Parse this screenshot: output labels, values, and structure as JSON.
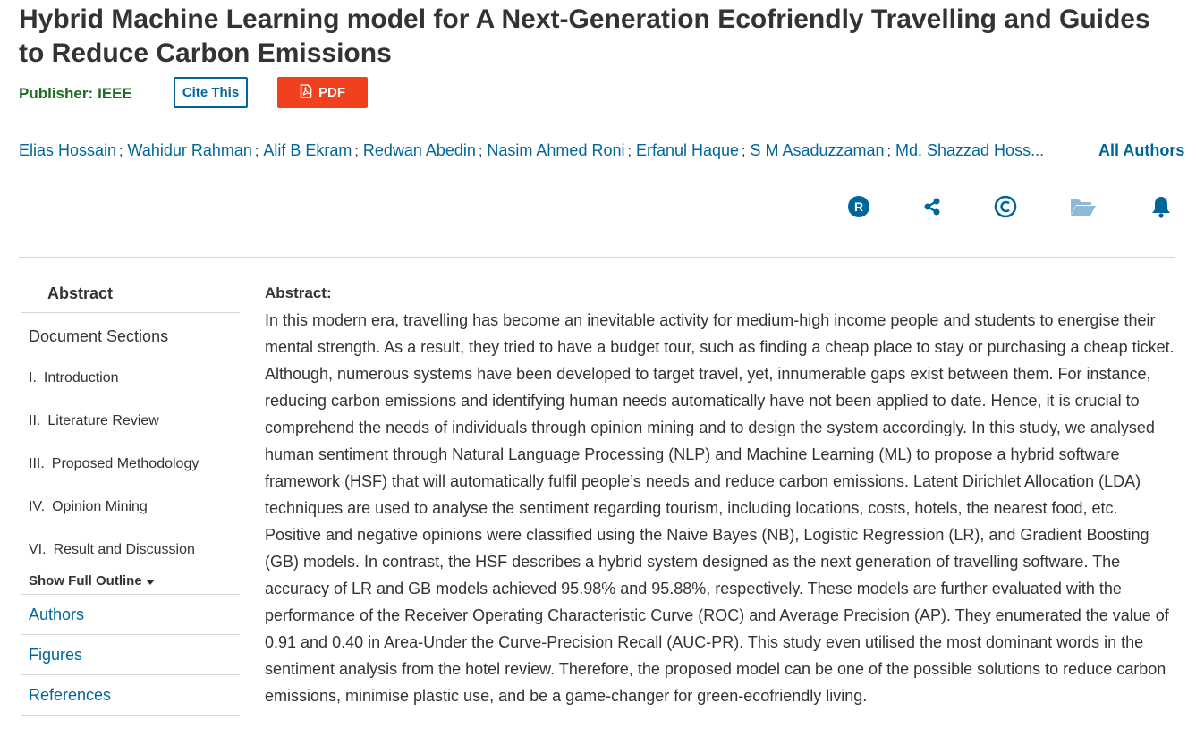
{
  "title": "Hybrid Machine Learning model for A Next-Generation Ecofriendly Travelling and Guides to Reduce Carbon Emissions",
  "publisher": {
    "label": "Publisher:",
    "name": "IEEE"
  },
  "buttons": {
    "cite": "Cite This",
    "pdf": "PDF"
  },
  "authors": [
    "Elias Hossain",
    "Wahidur Rahman",
    "Alif B Ekram",
    "Redwan Abedin",
    "Nasim Ahmed Roni",
    "Erfanul Haque",
    "S M Asaduzzaman",
    "Md. Shazzad Hoss..."
  ],
  "author_separator": ";",
  "all_authors_label": "All Authors",
  "action_icons": [
    "rights-icon",
    "share-icon",
    "copyright-icon",
    "folder-icon",
    "bell-icon"
  ],
  "sidebar": {
    "abstract": "Abstract",
    "document_sections": "Document Sections",
    "sections": [
      {
        "num": "I.",
        "label": "Introduction"
      },
      {
        "num": "II.",
        "label": "Literature Review"
      },
      {
        "num": "III.",
        "label": "Proposed Methodology"
      },
      {
        "num": "IV.",
        "label": "Opinion Mining"
      },
      {
        "num": "VI.",
        "label": "Result and Discussion"
      }
    ],
    "show_full_outline": "Show Full Outline",
    "links": [
      "Authors",
      "Figures",
      "References"
    ]
  },
  "abstract": {
    "heading": "Abstract:",
    "text": "In this modern era, travelling has become an inevitable activity for medium-high income people and students to energise their mental strength. As a result, they tried to have a budget tour, such as finding a cheap place to stay or purchasing a cheap ticket. Although, numerous systems have been developed to target travel, yet, innumerable gaps exist between them. For instance, reducing carbon emissions and identifying human needs automatically have not been applied to date. Hence, it is crucial to comprehend the needs of individuals through opinion mining and to design the system accordingly. In this study, we analysed human sentiment through Natural Language Processing (NLP) and Machine Learning (ML) to propose a hybrid software framework (HSF) that will automatically fulfil people’s needs and reduce carbon emissions. Latent Dirichlet Allocation (LDA) techniques are used to analyse the sentiment regarding tourism, including locations, costs, hotels, the nearest food, etc. Positive and negative opinions were classified using the Naive Bayes (NB), Logistic Regression (LR), and Gradient Boosting (GB) models. In contrast, the HSF describes a hybrid system designed as the next generation of travelling software. The accuracy of LR and GB models achieved 95.98% and 95.88%, respectively. These models are further evaluated with the performance of the Receiver Operating Characteristic Curve (ROC) and Average Precision (AP). They enumerated the value of 0.91 and 0.40 in Area-Under the Curve-Precision Recall (AUC-PR). This study even utilised the most dominant words in the sentiment analysis from the hotel review. Therefore, the proposed model can be one of the possible solutions to reduce carbon emissions, minimise plastic use, and be a game-changer for green-ecofriendly living."
  },
  "colors": {
    "link": "#006699",
    "publisher": "#1e6b1e",
    "pdf_button": "#f0401e",
    "text": "#333333",
    "divider": "#d6d6d6"
  }
}
